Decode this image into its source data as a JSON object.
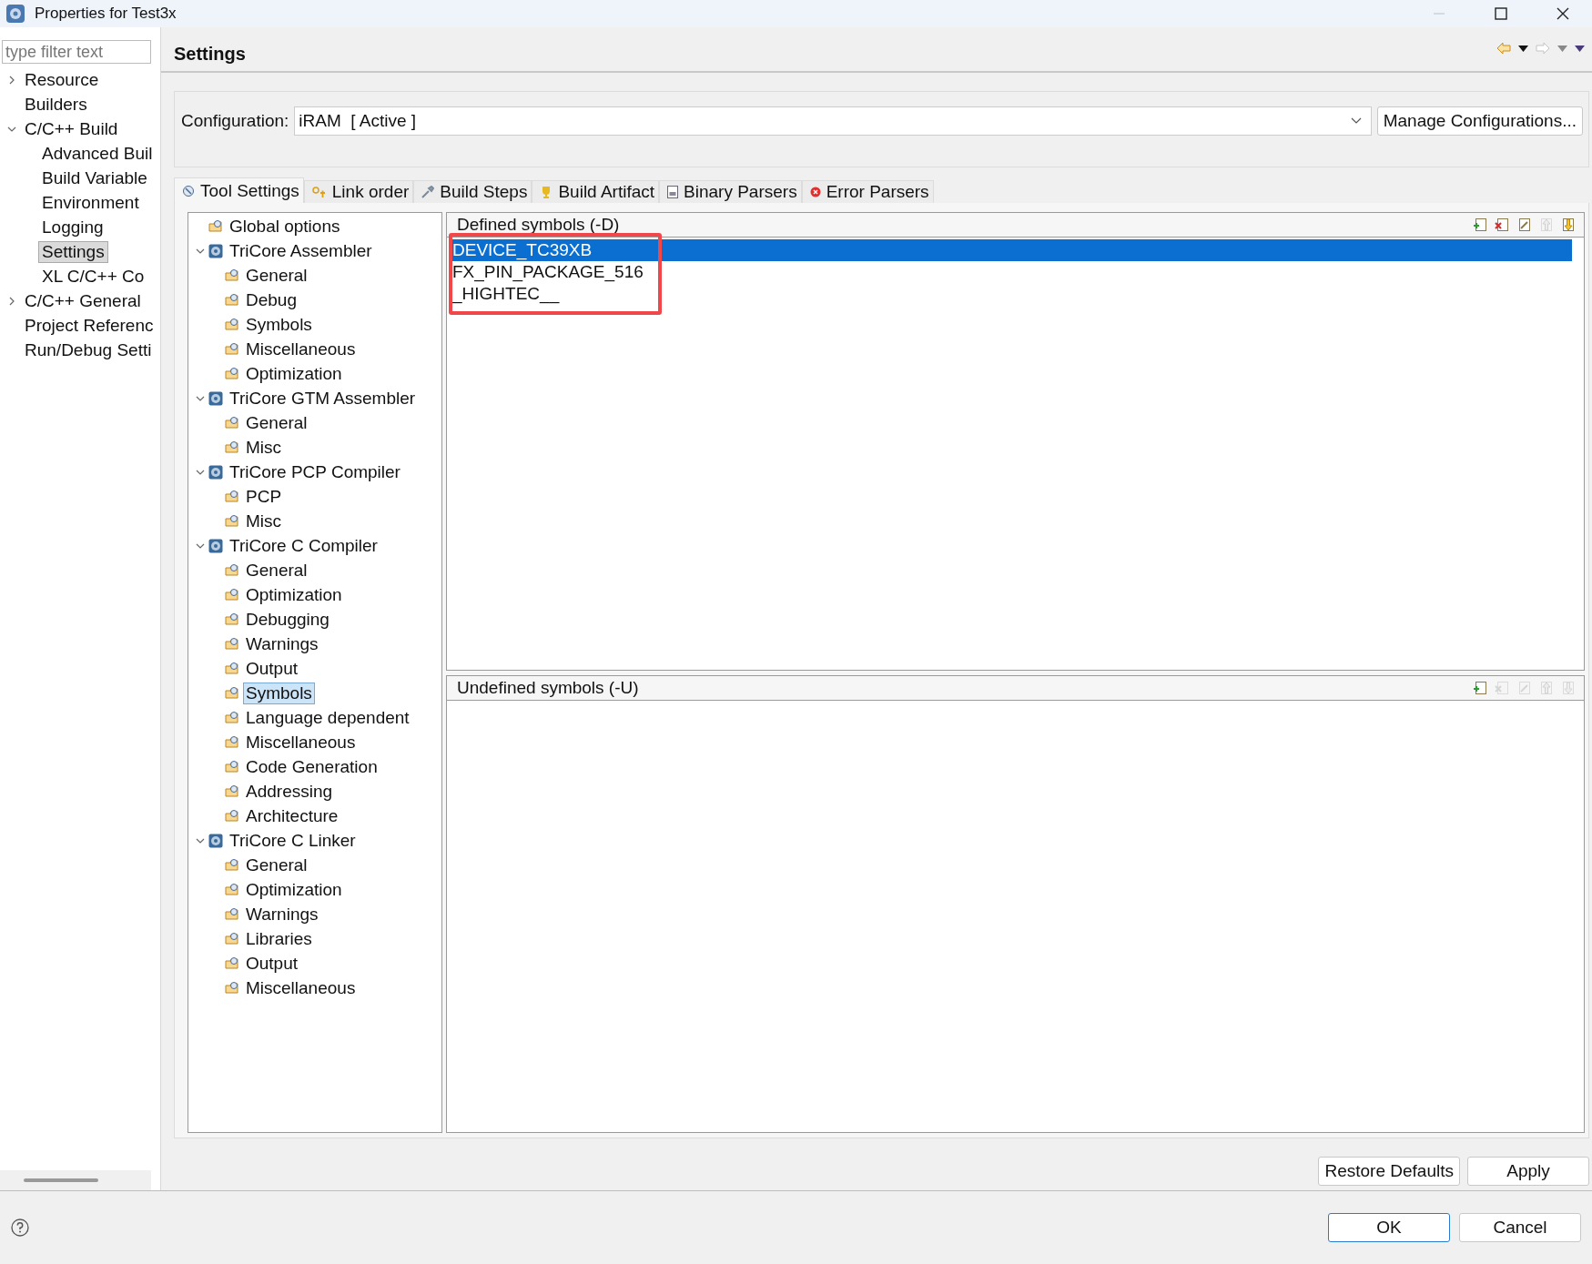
{
  "window": {
    "title": "Properties for Test3x"
  },
  "sidebar": {
    "filter": {
      "placeholder": "type filter text"
    },
    "items": [
      {
        "label": "Resource",
        "kind": "group",
        "expanded": false,
        "selected": false
      },
      {
        "label": "Builders",
        "kind": "leaf",
        "selected": false
      },
      {
        "label": "C/C++ Build",
        "kind": "group",
        "expanded": true,
        "selected": false,
        "children": [
          {
            "label": "Advanced Buil",
            "kind": "leaf",
            "selected": false
          },
          {
            "label": "Build Variable",
            "kind": "leaf",
            "selected": false
          },
          {
            "label": "Environment",
            "kind": "leaf",
            "selected": false
          },
          {
            "label": "Logging",
            "kind": "leaf",
            "selected": false
          },
          {
            "label": "Settings",
            "kind": "leaf",
            "selected": true
          },
          {
            "label": "XL C/C++ Co",
            "kind": "leaf",
            "selected": false
          }
        ]
      },
      {
        "label": "C/C++ General",
        "kind": "group",
        "expanded": false,
        "selected": false
      },
      {
        "label": "Project Referenc",
        "kind": "leaf",
        "selected": false
      },
      {
        "label": "Run/Debug Setti",
        "kind": "leaf",
        "selected": false
      }
    ]
  },
  "header": {
    "title": "Settings"
  },
  "configuration": {
    "label": "Configuration:",
    "value": "iRAM  [ Active ]",
    "button": "Manage Configurations..."
  },
  "tabs": [
    {
      "label": "Tool Settings",
      "kind": "tool",
      "selected": true
    },
    {
      "label": "Link order",
      "kind": "link",
      "selected": false
    },
    {
      "label": "Build Steps",
      "kind": "steps",
      "selected": false
    },
    {
      "label": "Build Artifact",
      "kind": "artifact",
      "selected": false
    },
    {
      "label": "Binary Parsers",
      "kind": "binary",
      "selected": false
    },
    {
      "label": "Error Parsers",
      "kind": "error",
      "selected": false
    }
  ],
  "tool_tree": {
    "items": [
      {
        "label": "Global options",
        "kind": "leaf",
        "selected": false
      },
      {
        "label": "TriCore Assembler",
        "kind": "group",
        "expanded": true,
        "selected": false,
        "children": [
          {
            "label": "General",
            "kind": "leaf",
            "selected": false
          },
          {
            "label": "Debug",
            "kind": "leaf",
            "selected": false
          },
          {
            "label": "Symbols",
            "kind": "leaf",
            "selected": false
          },
          {
            "label": "Miscellaneous",
            "kind": "leaf",
            "selected": false
          },
          {
            "label": "Optimization",
            "kind": "leaf",
            "selected": false
          }
        ]
      },
      {
        "label": "TriCore GTM Assembler",
        "kind": "group",
        "expanded": true,
        "selected": false,
        "children": [
          {
            "label": "General",
            "kind": "leaf",
            "selected": false
          },
          {
            "label": "Misc",
            "kind": "leaf",
            "selected": false
          }
        ]
      },
      {
        "label": "TriCore PCP Compiler",
        "kind": "group",
        "expanded": true,
        "selected": false,
        "children": [
          {
            "label": "PCP",
            "kind": "leaf",
            "selected": false
          },
          {
            "label": "Misc",
            "kind": "leaf",
            "selected": false
          }
        ]
      },
      {
        "label": "TriCore C Compiler",
        "kind": "group",
        "expanded": true,
        "selected": false,
        "children": [
          {
            "label": "General",
            "kind": "leaf",
            "selected": false
          },
          {
            "label": "Optimization",
            "kind": "leaf",
            "selected": false
          },
          {
            "label": "Debugging",
            "kind": "leaf",
            "selected": false
          },
          {
            "label": "Warnings",
            "kind": "leaf",
            "selected": false
          },
          {
            "label": "Output",
            "kind": "leaf",
            "selected": false
          },
          {
            "label": "Symbols",
            "kind": "leaf",
            "selected": true
          },
          {
            "label": "Language dependent",
            "kind": "leaf",
            "selected": false
          },
          {
            "label": "Miscellaneous",
            "kind": "leaf",
            "selected": false
          },
          {
            "label": "Code Generation",
            "kind": "leaf",
            "selected": false
          },
          {
            "label": "Addressing",
            "kind": "leaf",
            "selected": false
          },
          {
            "label": "Architecture",
            "kind": "leaf",
            "selected": false
          }
        ]
      },
      {
        "label": "TriCore C Linker",
        "kind": "group",
        "expanded": true,
        "selected": false,
        "children": [
          {
            "label": "General",
            "kind": "leaf",
            "selected": false
          },
          {
            "label": "Optimization",
            "kind": "leaf",
            "selected": false
          },
          {
            "label": "Warnings",
            "kind": "leaf",
            "selected": false
          },
          {
            "label": "Libraries",
            "kind": "leaf",
            "selected": false
          },
          {
            "label": "Output",
            "kind": "leaf",
            "selected": false
          },
          {
            "label": "Miscellaneous",
            "kind": "leaf",
            "selected": false
          }
        ]
      }
    ]
  },
  "symbol_lists": [
    {
      "title": "Defined symbols (-D)",
      "tools": [
        {
          "kind": "add",
          "disabled": false
        },
        {
          "kind": "delete",
          "disabled": false
        },
        {
          "kind": "edit",
          "disabled": false
        },
        {
          "kind": "up",
          "disabled": true
        },
        {
          "kind": "down",
          "disabled": false
        }
      ],
      "items": [
        {
          "text": "DEVICE_TC39XB",
          "selected": true
        },
        {
          "text": "FX_PIN_PACKAGE_516",
          "selected": false
        },
        {
          "text": "_HIGHTEC__",
          "selected": false
        }
      ],
      "highlighted": true
    },
    {
      "title": "Undefined symbols (-U)",
      "tools": [
        {
          "kind": "add",
          "disabled": false
        },
        {
          "kind": "delete",
          "disabled": true
        },
        {
          "kind": "edit",
          "disabled": true
        },
        {
          "kind": "up",
          "disabled": true
        },
        {
          "kind": "down",
          "disabled": true
        }
      ],
      "highlighted": false
    }
  ],
  "page_buttons": [
    "Restore Defaults",
    "Apply"
  ],
  "dialog_buttons": [
    {
      "label": "OK",
      "default": true
    },
    {
      "label": "Cancel",
      "default": false
    }
  ]
}
